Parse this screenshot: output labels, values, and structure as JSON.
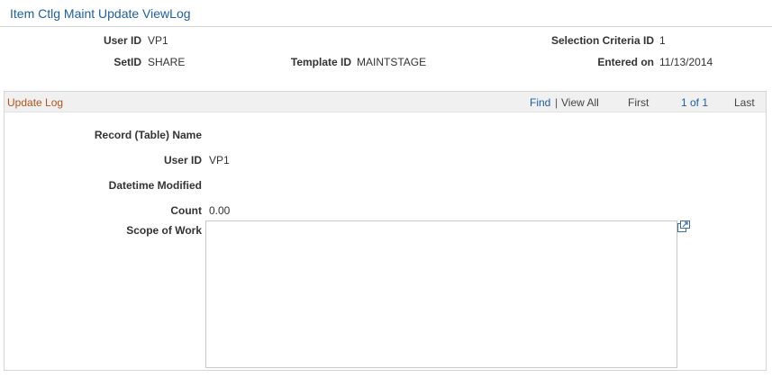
{
  "page": {
    "title": "Item Ctlg Maint Update ViewLog"
  },
  "header": {
    "user_id_label": "User ID",
    "user_id_value": "VP1",
    "selection_criteria_label": "Selection Criteria ID",
    "selection_criteria_value": "1",
    "setid_label": "SetID",
    "setid_value": "SHARE",
    "template_id_label": "Template ID",
    "template_id_value": "MAINTSTAGE",
    "entered_on_label": "Entered on",
    "entered_on_value": "11/13/2014"
  },
  "update_log": {
    "title": "Update Log",
    "nav": {
      "find": "Find",
      "separator": "|",
      "view_all": "View All",
      "first": "First",
      "page_indicator": "1 of 1",
      "last": "Last"
    },
    "fields": {
      "record_name_label": "Record (Table) Name",
      "record_name_value": "",
      "user_id_label": "User ID",
      "user_id_value": "VP1",
      "datetime_modified_label": "Datetime Modified",
      "datetime_modified_value": "",
      "count_label": "Count",
      "count_value": "0.00",
      "scope_label": "Scope of Work",
      "scope_value": ""
    }
  }
}
